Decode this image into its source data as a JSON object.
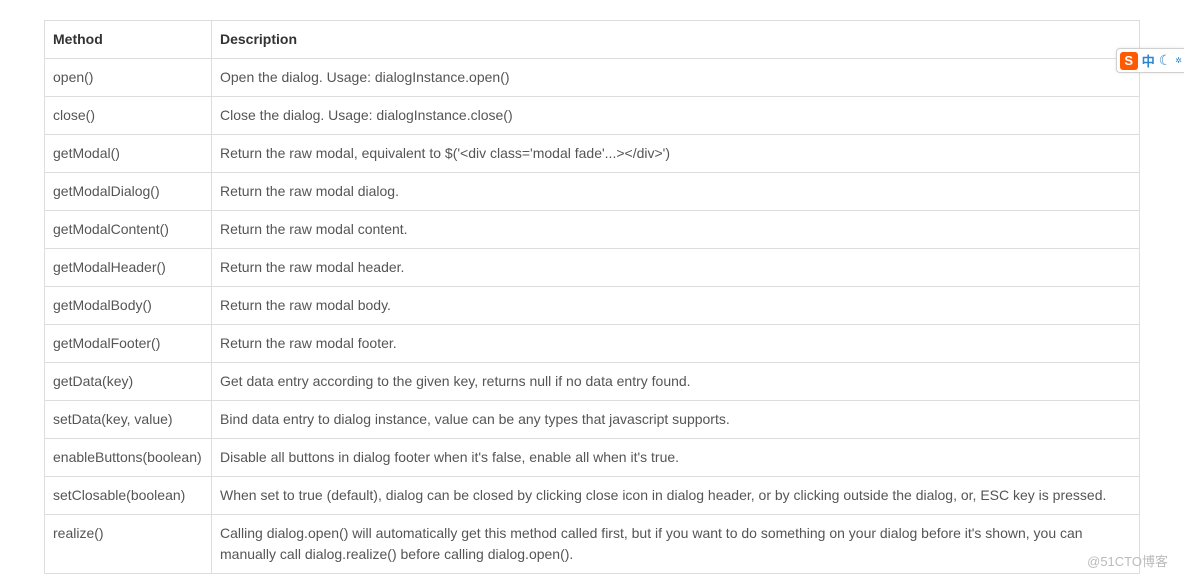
{
  "table": {
    "headers": {
      "method": "Method",
      "description": "Description"
    },
    "rows": [
      {
        "method": "open()",
        "description": "Open the dialog. Usage: dialogInstance.open()"
      },
      {
        "method": "close()",
        "description": "Close the dialog. Usage: dialogInstance.close()"
      },
      {
        "method": "getModal()",
        "description": "Return the raw modal, equivalent to $('<div class='modal fade'...></div>')"
      },
      {
        "method": "getModalDialog()",
        "description": "Return the raw modal dialog."
      },
      {
        "method": "getModalContent()",
        "description": "Return the raw modal content."
      },
      {
        "method": "getModalHeader()",
        "description": "Return the raw modal header."
      },
      {
        "method": "getModalBody()",
        "description": "Return the raw modal body."
      },
      {
        "method": "getModalFooter()",
        "description": "Return the raw modal footer."
      },
      {
        "method": "getData(key)",
        "description": "Get data entry according to the given key, returns null if no data entry found."
      },
      {
        "method": "setData(key, value)",
        "description": "Bind data entry to dialog instance, value can be any types that javascript supports."
      },
      {
        "method": "enableButtons(boolean)",
        "description": "Disable all buttons in dialog footer when it's false, enable all when it's true."
      },
      {
        "method": "setClosable(boolean)",
        "description": "When set to true (default), dialog can be closed by clicking close icon in dialog header, or by clicking outside the dialog, or, ESC key is pressed."
      },
      {
        "method": "realize()",
        "description": "Calling dialog.open() will automatically get this method called first, but if you want to do something on your dialog before it's shown, you can manually call dialog.realize() before calling dialog.open()."
      }
    ]
  },
  "ime": {
    "logo_letter": "S",
    "lang": "中",
    "moon": "☾",
    "gear": "✲"
  },
  "watermark": "@51CTO博客"
}
